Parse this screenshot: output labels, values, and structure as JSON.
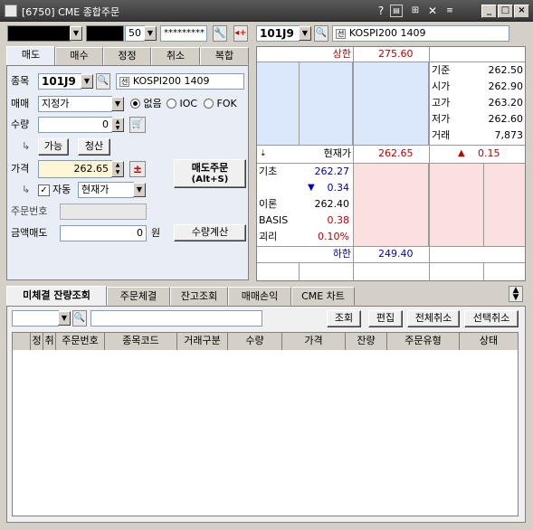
{
  "window": {
    "title": "[6750] CME 종합주문"
  },
  "titlebar": {
    "help": "?",
    "min": "_",
    "max": "□",
    "close": "×"
  },
  "account": {
    "masked_password": "*********",
    "qty": "50"
  },
  "top_symbol": {
    "code": "101J9",
    "badge": "선",
    "name": "KOSPI200 1409"
  },
  "tabs": [
    "매도",
    "매수",
    "정정",
    "취소",
    "복합"
  ],
  "order": {
    "code_label": "종목",
    "code": "101J9",
    "badge": "선",
    "name": "KOSPI200 1409",
    "trade_label": "매매",
    "trade_type": "지정가",
    "opt_none": "없음",
    "opt_ioc": "IOC",
    "opt_fok": "FOK",
    "qty_label": "수량",
    "qty": "0",
    "avail_btn": "가능",
    "clear_btn": "청산",
    "price_label": "가격",
    "price": "262.65",
    "plusminus": "±",
    "submit_btn_line1": "매도주문",
    "submit_btn_line2": "(Alt+S)",
    "auto_label": "자동",
    "auto_value": "현재가",
    "orderno_label": "주문번호",
    "amount_label": "금액매도",
    "amount": "0",
    "won": "원",
    "calc_btn": "수량계산"
  },
  "quote": {
    "upper_label": "상한",
    "upper": "275.60",
    "info": [
      {
        "label": "기준",
        "value": "262.50"
      },
      {
        "label": "시가",
        "value": "262.90"
      },
      {
        "label": "고가",
        "value": "263.20"
      },
      {
        "label": "저가",
        "value": "262.60"
      },
      {
        "label": "거래",
        "value": "7,873"
      }
    ],
    "current_label": "현재가",
    "current": "262.65",
    "change_arrow": "▲",
    "change": "0.15",
    "theory_base_label": "기초",
    "theory_base": "262.27",
    "theory_base_chg_arrow": "▼",
    "theory_base_chg": "0.34",
    "theory_label": "이론",
    "theory": "262.40",
    "basis_label": "BASIS",
    "basis": "0.38",
    "gap_label": "괴리",
    "gap": "0.10%",
    "lower_label": "하한",
    "lower": "249.40"
  },
  "bottom_tabs": [
    "미체결 잔량조회",
    "주문체결",
    "잔고조회",
    "매매손익",
    "CME 차트"
  ],
  "bottom_toolbar": {
    "query_btn": "조회",
    "edit_btn": "편집",
    "cancel_all_btn": "전체취소",
    "cancel_sel_btn": "선택취소"
  },
  "table_headers": [
    "정",
    "취",
    "주문번호",
    "종목코드",
    "거래구분",
    "수량",
    "가격",
    "잔량",
    "주문유형",
    "상태"
  ],
  "colors": {
    "panel_bg": "#e9eef6",
    "ask_bg": "#dbe8fb",
    "bid_bg": "#fbe0e0",
    "price_bg": "#fff6d6"
  }
}
